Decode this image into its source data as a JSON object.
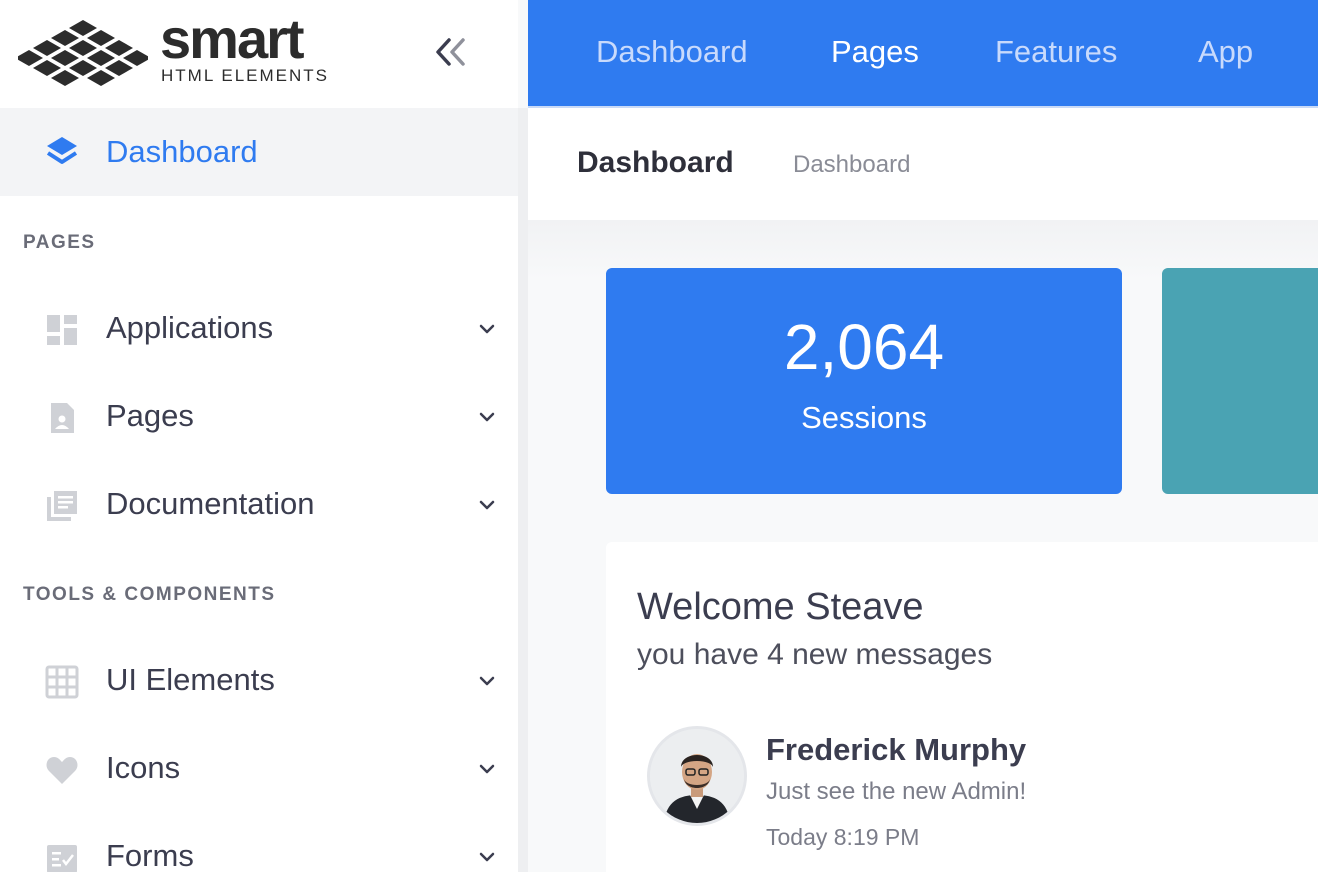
{
  "brand": {
    "name": "smart",
    "subtitle": "HTML ELEMENTS"
  },
  "sidebar": {
    "active_item": {
      "label": "Dashboard",
      "icon": "layers-icon"
    },
    "sections": [
      {
        "title": "PAGES",
        "items": [
          {
            "label": "Applications",
            "icon": "dashboard-grid-icon"
          },
          {
            "label": "Pages",
            "icon": "document-icon"
          },
          {
            "label": "Documentation",
            "icon": "library-books-icon"
          }
        ]
      },
      {
        "title": "TOOLS & COMPONENTS",
        "items": [
          {
            "label": "UI Elements",
            "icon": "grid-icon"
          },
          {
            "label": "Icons",
            "icon": "heart-icon"
          },
          {
            "label": "Forms",
            "icon": "form-checklist-icon"
          }
        ]
      }
    ]
  },
  "topnav": {
    "links": [
      "Dashboard",
      "Pages",
      "Features",
      "App"
    ],
    "active": "Pages"
  },
  "header": {
    "title": "Dashboard",
    "breadcrumb": "Dashboard"
  },
  "stats": [
    {
      "value": "2,064",
      "label": "Sessions",
      "color": "#2f7bf0"
    },
    {
      "value": "",
      "label": "",
      "color": "#4aa3b3"
    }
  ],
  "welcome": {
    "title": "Welcome Steave",
    "subtitle": "you have 4 new messages",
    "message": {
      "name": "Frederick Murphy",
      "text": "Just see the new Admin!",
      "time": "Today 8:19 PM"
    }
  },
  "colors": {
    "primary": "#2f7bf0",
    "teal": "#4aa3b3",
    "sidebar_active_bg": "#f3f4f6"
  }
}
